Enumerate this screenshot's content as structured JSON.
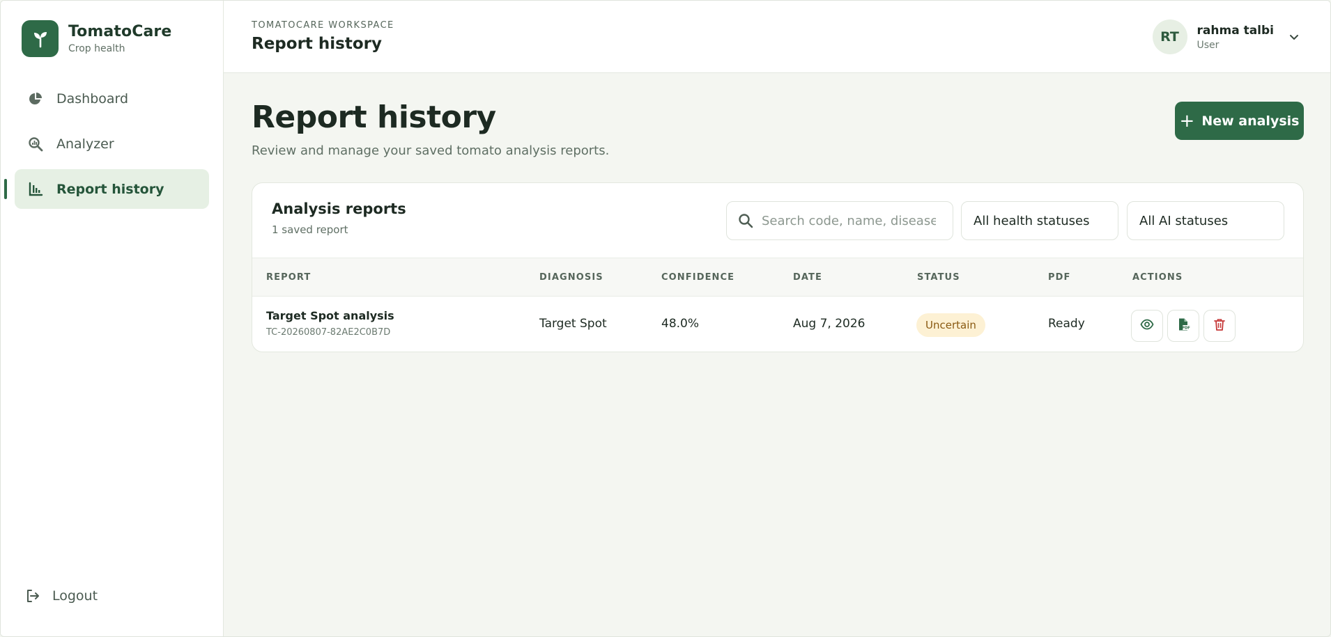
{
  "brand": {
    "name": "TomatoCare",
    "subtitle": "Crop health"
  },
  "sidebar": {
    "items": [
      {
        "label": "Dashboard",
        "icon": "pie-chart-icon"
      },
      {
        "label": "Analyzer",
        "icon": "search-analytics-icon"
      },
      {
        "label": "Report history",
        "icon": "bar-chart-icon",
        "active": true
      }
    ],
    "logout_label": "Logout"
  },
  "header": {
    "workspace_label": "TOMATOCARE WORKSPACE",
    "title": "Report history",
    "user": {
      "initials": "RT",
      "name": "rahma talbi",
      "role": "User"
    }
  },
  "main": {
    "title": "Report history",
    "subtitle": "Review and manage your saved tomato analysis reports.",
    "new_button_label": "New analysis",
    "card": {
      "title": "Analysis reports",
      "count_text": "1 saved report",
      "search_placeholder": "Search code, name, disease",
      "filter_health": "All health statuses",
      "filter_ai": "All AI statuses",
      "columns": [
        "REPORT",
        "DIAGNOSIS",
        "CONFIDENCE",
        "DATE",
        "STATUS",
        "PDF",
        "ACTIONS"
      ],
      "rows": [
        {
          "name": "Target Spot analysis",
          "code": "TC-20260807-82AE2C0B7D",
          "diagnosis": "Target Spot",
          "confidence": "48.0%",
          "date": "Aug 7, 2026",
          "status": "Uncertain",
          "pdf": "Ready"
        }
      ]
    }
  },
  "colors": {
    "brand": "#2e6a47",
    "badge_bg": "#fdf1d4",
    "badge_text": "#8a5a12",
    "delete": "#c63a3a"
  }
}
